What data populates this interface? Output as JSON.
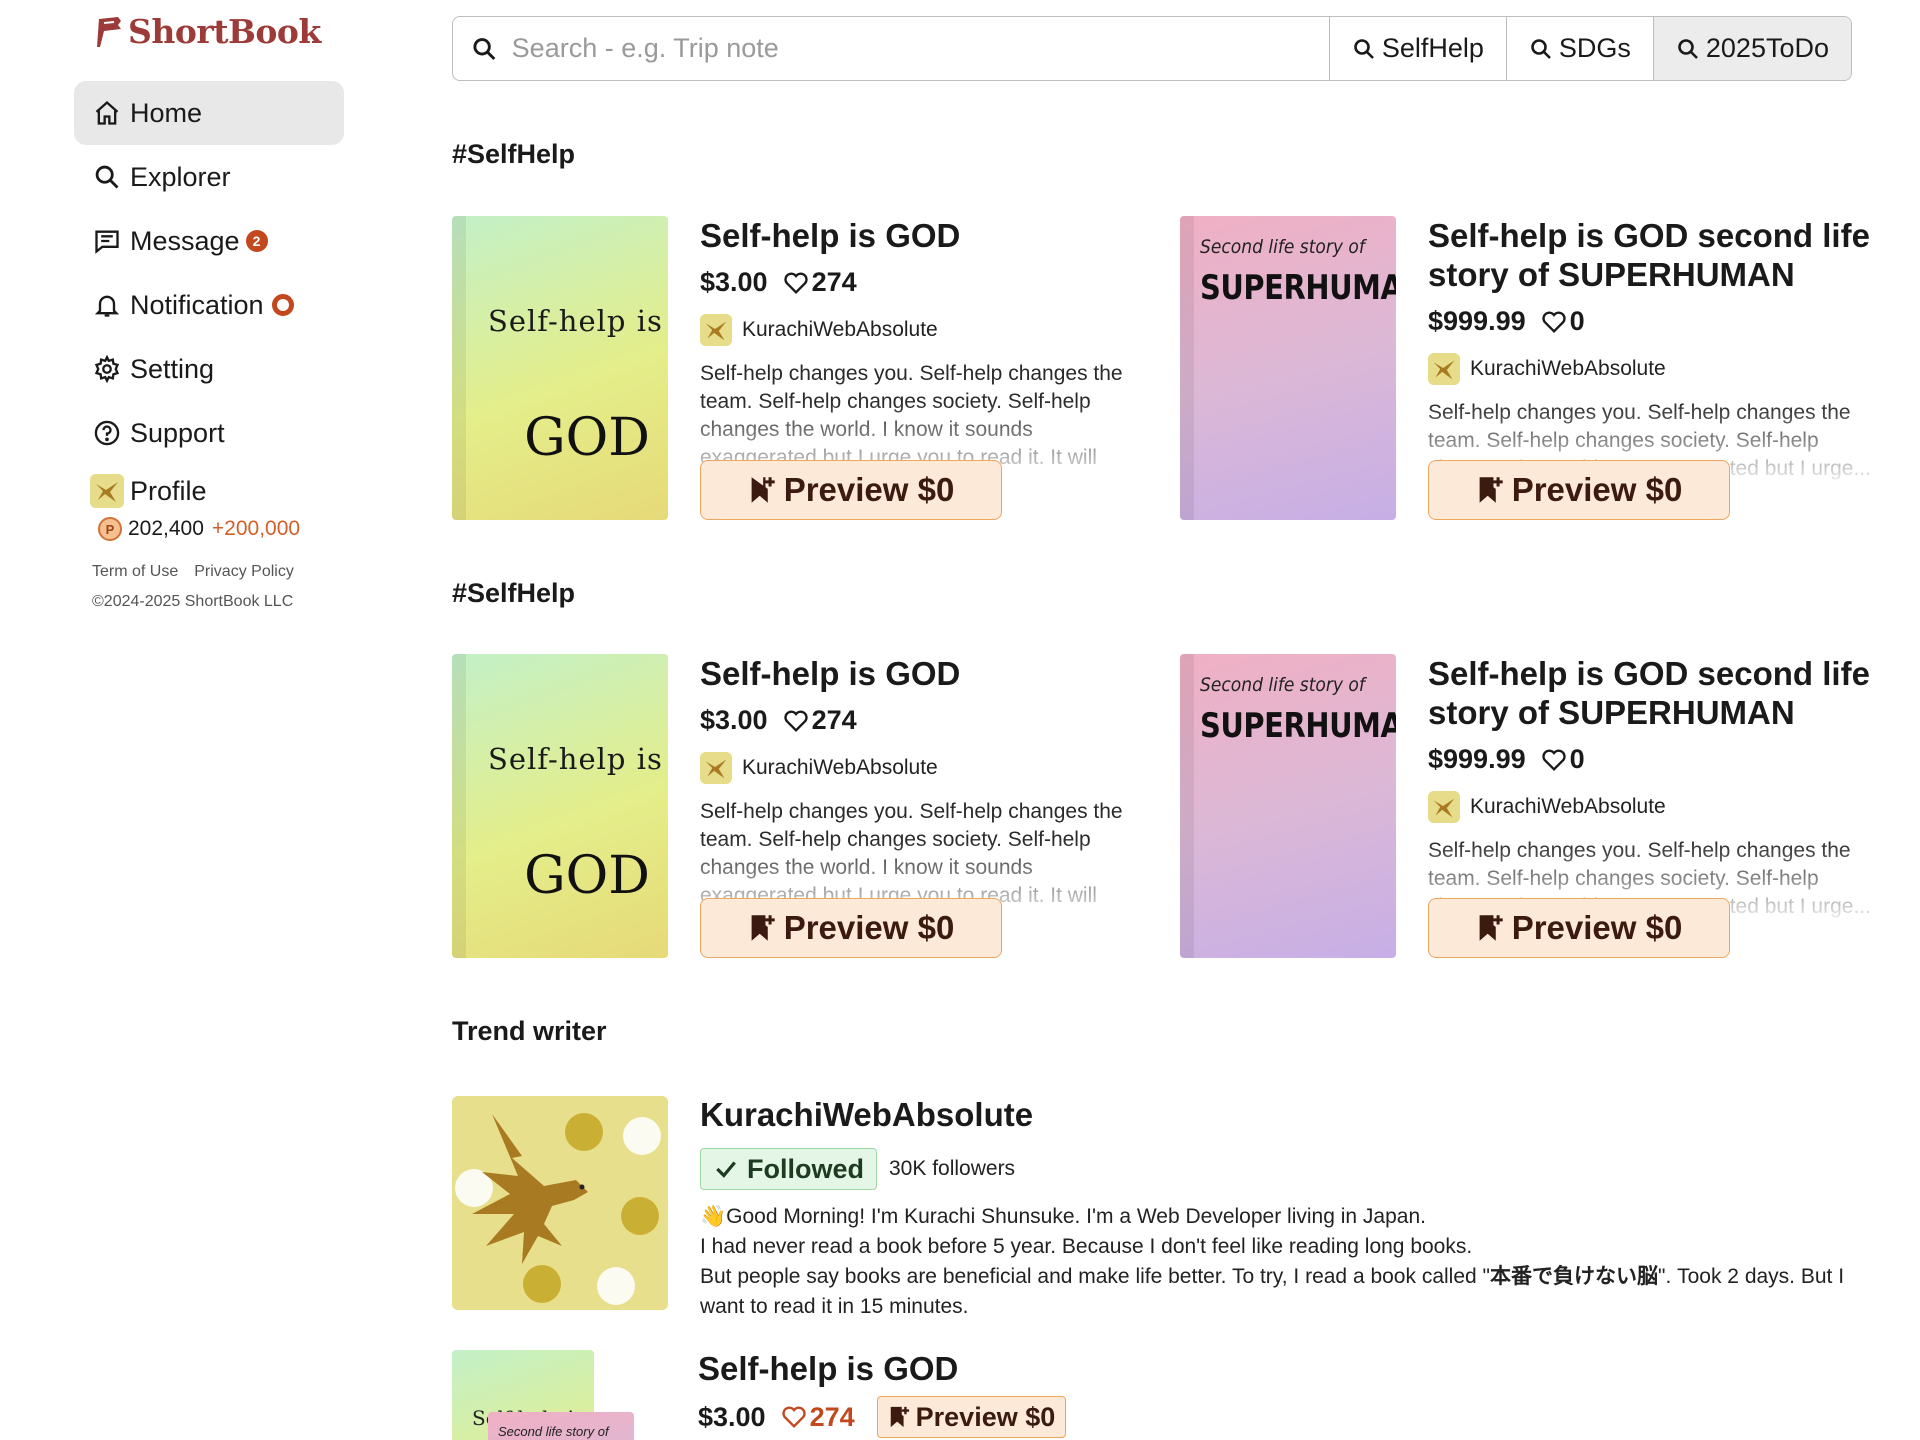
{
  "app": {
    "name": "ShortBook",
    "brand_color": "#9c3b38",
    "accent_color": "#c2491d"
  },
  "sidebar": {
    "items": [
      {
        "label": "Home",
        "icon": "home-icon",
        "active": true
      },
      {
        "label": "Explorer",
        "icon": "search-icon"
      },
      {
        "label": "Message",
        "icon": "message-icon",
        "badge": "2"
      },
      {
        "label": "Notification",
        "icon": "bell-icon",
        "badge": "ring"
      },
      {
        "label": "Setting",
        "icon": "gear-icon"
      },
      {
        "label": "Support",
        "icon": "help-icon"
      }
    ],
    "profile": {
      "label": "Profile",
      "points": "202,400",
      "points_delta": "+200,000",
      "coin_letter": "P"
    },
    "footer": {
      "terms": "Term of Use",
      "privacy": "Privacy Policy",
      "copyright": "©2024-2025 ShortBook LLC"
    }
  },
  "search": {
    "placeholder": "Search - e.g. Trip note",
    "tags": [
      "SelfHelp",
      "SDGs",
      "2025ToDo"
    ]
  },
  "sections": [
    {
      "title": "#SelfHelp",
      "books": [
        {
          "title": "Self-help is GOD",
          "price": "$3.00",
          "likes": "274",
          "author": "KurachiWebAbsolute",
          "description": "Self-help changes you. Self-help changes the team. Self-help changes society. Self-help changes the world. I know it sounds exaggerated but I urge you to read it. It will surely be useful to...",
          "cover_line1": "Self-help is",
          "cover_line2": "GOD",
          "preview": "Preview $0"
        },
        {
          "title": "Self-help is GOD second life story of SUPERHUMAN",
          "price": "$999.99",
          "likes": "0",
          "author": "KurachiWebAbsolute",
          "description": "Self-help changes you. Self-help changes the team. Self-help changes society. Self-help changes the world. It's exaggerated but I urge...",
          "cover_line1": "Second life story of",
          "cover_line2": "SUPERHUMAN",
          "preview": "Preview $0"
        }
      ]
    },
    {
      "title": "#SelfHelp",
      "books": [
        {
          "title": "Self-help is GOD",
          "price": "$3.00",
          "likes": "274",
          "author": "KurachiWebAbsolute",
          "description": "Self-help changes you. Self-help changes the team. Self-help changes society. Self-help changes the world. I know it sounds exaggerated but I urge you to read it. It will surely be useful to...",
          "cover_line1": "Self-help is",
          "cover_line2": "GOD",
          "preview": "Preview $0"
        },
        {
          "title": "Self-help is GOD second life story of SUPERHUMAN",
          "price": "$999.99",
          "likes": "0",
          "author": "KurachiWebAbsolute",
          "description": "Self-help changes you. Self-help changes the team. Self-help changes society. Self-help changes the world. It's exaggerated but I urge...",
          "cover_line1": "Second life story of",
          "cover_line2": "SUPERHUMAN",
          "preview": "Preview $0"
        }
      ]
    }
  ],
  "trend": {
    "title": "Trend writer",
    "writer": {
      "name": "KurachiWebAbsolute",
      "followed_label": "Followed",
      "followers": "30K followers",
      "bio_line1": "👋Good Morning! I'm Kurachi Shunsuke. I'm a Web Developer living in Japan.",
      "bio_line2": "I had never read a book before 5 year. Because I don't feel like reading long books.",
      "bio_line3_pre": "But people say books are beneficial and make life better. To try, I read a book called \"",
      "bio_line3_bold": "本番で負けない脳",
      "bio_line3_post": "\". Took 2 days. But I want to read it in 15 minutes."
    },
    "book": {
      "title": "Self-help is GOD",
      "price": "$3.00",
      "likes": "274",
      "preview": "Preview $0",
      "cover1_text": "Self-help is",
      "cover2_text": "Second life story of"
    }
  }
}
